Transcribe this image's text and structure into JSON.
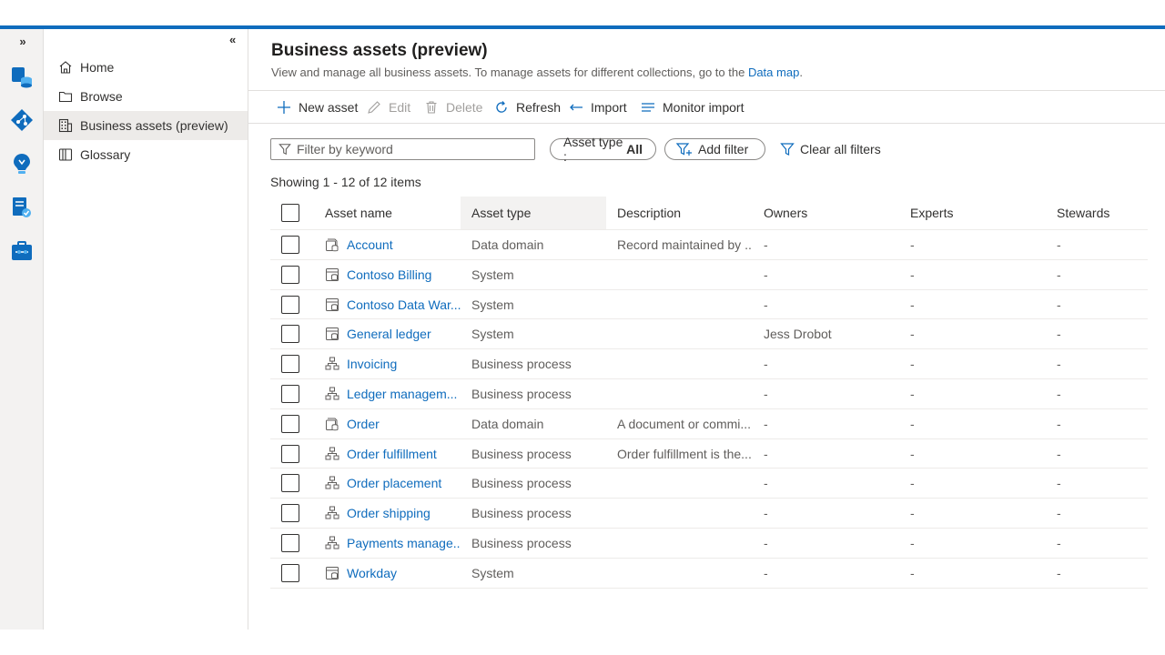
{
  "colors": {
    "accent": "#0f6cbd",
    "text": "#323130",
    "muted": "#605e5c",
    "selected_bg": "#edebe9"
  },
  "rail": {
    "expand_label": "»",
    "icons": [
      "data-map-icon",
      "data-catalog-icon",
      "insights-icon",
      "policy-icon",
      "management-icon"
    ]
  },
  "nav": {
    "collapse_label": "«",
    "items": [
      {
        "label": "Home",
        "icon": "home-icon"
      },
      {
        "label": "Browse",
        "icon": "folder-icon"
      },
      {
        "label": "Business assets (preview)",
        "icon": "building-icon",
        "selected": true
      },
      {
        "label": "Glossary",
        "icon": "book-icon"
      }
    ]
  },
  "page": {
    "title": "Business assets (preview)",
    "subtitle": "View and manage all business assets. To manage assets for different collections, go to the",
    "subtitle_link": "Data map",
    "subtitle_end": "."
  },
  "toolbar": {
    "new_asset": "New asset",
    "edit": "Edit",
    "delete": "Delete",
    "refresh": "Refresh",
    "import": "Import",
    "monitor_import": "Monitor import"
  },
  "filters": {
    "keyword_placeholder": "Filter by keyword",
    "asset_type_label": "Asset type :",
    "asset_type_value": "All",
    "add_filter": "Add filter",
    "clear_all": "Clear all filters"
  },
  "showing": "Showing 1 - 12 of 12 items",
  "table": {
    "columns": [
      "Asset name",
      "Asset type",
      "Description",
      "Owners",
      "Experts",
      "Stewards"
    ],
    "rows": [
      {
        "name": "Account",
        "icon": "data-domain-icon",
        "type": "Data domain",
        "description": "Record maintained by ...",
        "owners": "-",
        "experts": "-",
        "stewards": "-"
      },
      {
        "name": "Contoso Billing",
        "icon": "system-icon",
        "type": "System",
        "description": "",
        "owners": "-",
        "experts": "-",
        "stewards": "-"
      },
      {
        "name": "Contoso Data War...",
        "icon": "system-icon",
        "type": "System",
        "description": "",
        "owners": "-",
        "experts": "-",
        "stewards": "-"
      },
      {
        "name": "General ledger",
        "icon": "system-icon",
        "type": "System",
        "description": "",
        "owners": "Jess Drobot",
        "experts": "-",
        "stewards": "-"
      },
      {
        "name": "Invoicing",
        "icon": "business-process-icon",
        "type": "Business process",
        "description": "",
        "owners": "-",
        "experts": "-",
        "stewards": "-"
      },
      {
        "name": "Ledger managem...",
        "icon": "business-process-icon",
        "type": "Business process",
        "description": "",
        "owners": "-",
        "experts": "-",
        "stewards": "-"
      },
      {
        "name": "Order",
        "icon": "data-domain-icon",
        "type": "Data domain",
        "description": "A document or commi...",
        "owners": "-",
        "experts": "-",
        "stewards": "-"
      },
      {
        "name": "Order fulfillment",
        "icon": "business-process-icon",
        "type": "Business process",
        "description": "Order fulfillment is the...",
        "owners": "-",
        "experts": "-",
        "stewards": "-"
      },
      {
        "name": "Order placement",
        "icon": "business-process-icon",
        "type": "Business process",
        "description": "",
        "owners": "-",
        "experts": "-",
        "stewards": "-"
      },
      {
        "name": "Order shipping",
        "icon": "business-process-icon",
        "type": "Business process",
        "description": "",
        "owners": "-",
        "experts": "-",
        "stewards": "-"
      },
      {
        "name": "Payments manage...",
        "icon": "business-process-icon",
        "type": "Business process",
        "description": "",
        "owners": "-",
        "experts": "-",
        "stewards": "-"
      },
      {
        "name": "Workday",
        "icon": "system-icon",
        "type": "System",
        "description": "",
        "owners": "-",
        "experts": "-",
        "stewards": "-"
      }
    ]
  }
}
